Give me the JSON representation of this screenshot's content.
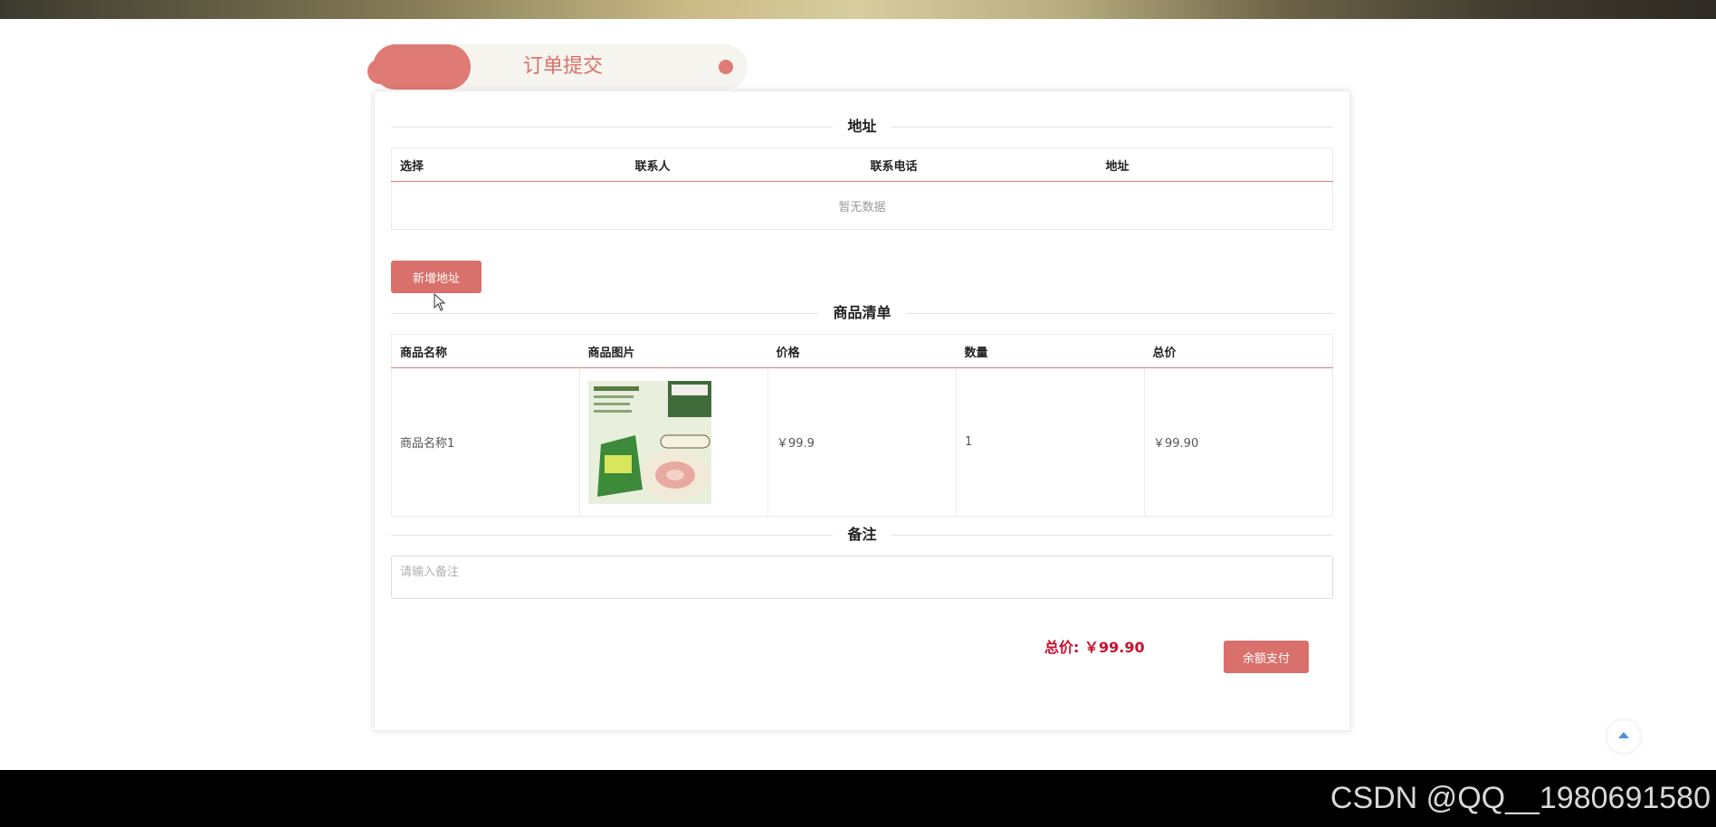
{
  "page": {
    "title": "订单提交"
  },
  "address_section": {
    "title": "地址",
    "columns": [
      "选择",
      "联系人",
      "联系电话",
      "地址"
    ],
    "empty_text": "暂无数据",
    "add_button": "新增地址"
  },
  "goods_section": {
    "title": "商品清单",
    "columns": [
      "商品名称",
      "商品图片",
      "价格",
      "数量",
      "总价"
    ],
    "rows": [
      {
        "name": "商品名称1",
        "image": "product-image",
        "price": "￥99.9",
        "quantity": "1",
        "total": "￥99.90"
      }
    ]
  },
  "remark_section": {
    "title": "备注",
    "placeholder": "请输入备注"
  },
  "footer": {
    "total_label": "总价:",
    "total_value": "￥99.90",
    "pay_button": "余额支付"
  },
  "watermark": "CSDN @QQ__1980691580",
  "colors": {
    "accent": "#d9706b",
    "price": "#c8102e"
  }
}
